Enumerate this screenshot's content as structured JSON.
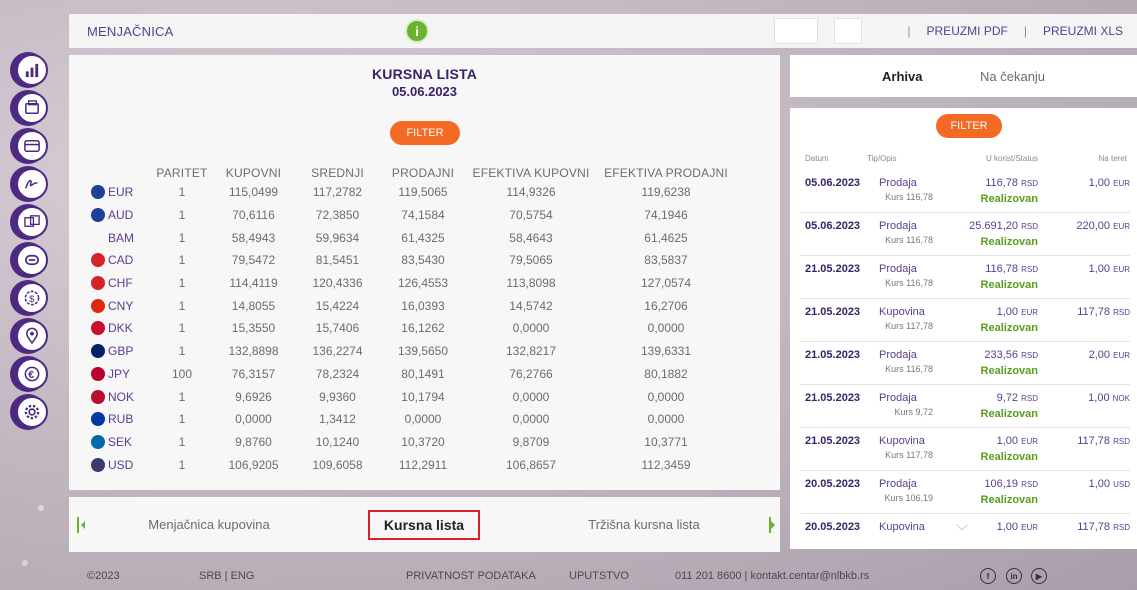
{
  "topbar": {
    "app_title": "MENJAČNICA",
    "info_icon": "info-icon",
    "separator": "|",
    "download_pdf": "PREUZMI PDF",
    "download_xls": "PREUZMI XLS"
  },
  "sidebar": {
    "items": [
      {
        "icon": "bar-chart-icon"
      },
      {
        "icon": "wallet-icon"
      },
      {
        "icon": "card-icon"
      },
      {
        "icon": "signature-icon"
      },
      {
        "icon": "money-transfer-icon"
      },
      {
        "icon": "loan-icon"
      },
      {
        "icon": "dollar-coin-icon"
      },
      {
        "icon": "location-pin-icon"
      },
      {
        "icon": "euro-exchange-icon"
      },
      {
        "icon": "gear-icon"
      }
    ],
    "accent": "#4c2a82"
  },
  "main": {
    "title": "KURSNA LISTA",
    "date": "05.06.2023",
    "filter_label": "FILTER",
    "columns": [
      "PARITET",
      "KUPOVNI",
      "SREDNJI",
      "PRODAJNI",
      "EFEKTIVA KUPOVNI",
      "EFEKTIVA PRODAJNI"
    ],
    "rows": [
      {
        "code": "EUR",
        "flag": "#1f3f9a",
        "paritet": "1",
        "kupovni": "115,0499",
        "srednji": "117,2782",
        "prodajni": "119,5065",
        "ef_kupovni": "114,9326",
        "ef_prodajni": "119,6238"
      },
      {
        "code": "AUD",
        "flag": "#1f3f9a",
        "paritet": "1",
        "kupovni": "70,6116",
        "srednji": "72,3850",
        "prodajni": "74,1584",
        "ef_kupovni": "70,5754",
        "ef_prodajni": "74,1946"
      },
      {
        "code": "BAM",
        "flag": "",
        "paritet": "1",
        "kupovni": "58,4943",
        "srednji": "59,9634",
        "prodajni": "61,4325",
        "ef_kupovni": "58,4643",
        "ef_prodajni": "61,4625"
      },
      {
        "code": "CAD",
        "flag": "#d7222a",
        "paritet": "1",
        "kupovni": "79,5472",
        "srednji": "81,5451",
        "prodajni": "83,5430",
        "ef_kupovni": "79,5065",
        "ef_prodajni": "83,5837"
      },
      {
        "code": "CHF",
        "flag": "#d7222a",
        "paritet": "1",
        "kupovni": "114,4119",
        "srednji": "120,4336",
        "prodajni": "126,4553",
        "ef_kupovni": "113,8098",
        "ef_prodajni": "127,0574"
      },
      {
        "code": "CNY",
        "flag": "#de2910",
        "paritet": "1",
        "kupovni": "14,8055",
        "srednji": "15,4224",
        "prodajni": "16,0393",
        "ef_kupovni": "14,5742",
        "ef_prodajni": "16,2706"
      },
      {
        "code": "DKK",
        "flag": "#c8102e",
        "paritet": "1",
        "kupovni": "15,3550",
        "srednji": "15,7406",
        "prodajni": "16,1262",
        "ef_kupovni": "0,0000",
        "ef_prodajni": "0,0000"
      },
      {
        "code": "GBP",
        "flag": "#012169",
        "paritet": "1",
        "kupovni": "132,8898",
        "srednji": "136,2274",
        "prodajni": "139,5650",
        "ef_kupovni": "132,8217",
        "ef_prodajni": "139,6331"
      },
      {
        "code": "JPY",
        "flag": "#bc002d",
        "paritet": "100",
        "kupovni": "76,3157",
        "srednji": "78,2324",
        "prodajni": "80,1491",
        "ef_kupovni": "76,2766",
        "ef_prodajni": "80,1882"
      },
      {
        "code": "NOK",
        "flag": "#ba0c2f",
        "paritet": "1",
        "kupovni": "9,6926",
        "srednji": "9,9360",
        "prodajni": "10,1794",
        "ef_kupovni": "0,0000",
        "ef_prodajni": "0,0000"
      },
      {
        "code": "RUB",
        "flag": "#0039a6",
        "paritet": "1",
        "kupovni": "0,0000",
        "srednji": "1,3412",
        "prodajni": "0,0000",
        "ef_kupovni": "0,0000",
        "ef_prodajni": "0,0000"
      },
      {
        "code": "SEK",
        "flag": "#006aa7",
        "paritet": "1",
        "kupovni": "9,8760",
        "srednji": "10,1240",
        "prodajni": "10,3720",
        "ef_kupovni": "9,8709",
        "ef_prodajni": "10,3771"
      },
      {
        "code": "USD",
        "flag": "#3c3b6e",
        "paritet": "1",
        "kupovni": "106,9205",
        "srednji": "109,6058",
        "prodajni": "112,2911",
        "ef_kupovni": "106,8657",
        "ef_prodajni": "112,3459"
      }
    ]
  },
  "tabs": [
    {
      "label": "Menjačnica kupovina"
    },
    {
      "label": "Kursna lista"
    },
    {
      "label": "Tržišna kursna lista"
    }
  ],
  "right": {
    "tab_archive": "Arhiva",
    "tab_pending": "Na čekanju",
    "filter_label": "FILTER",
    "headers": {
      "datum": "Datum",
      "tip": "Tip/Opis",
      "korist": "U korist/Status",
      "teret": "Na teret"
    },
    "transactions": [
      {
        "date": "05.06.2023",
        "type": "Prodaja",
        "kurs": "Kurs 116,78",
        "amount": "116,78",
        "amount_cur": "RSD",
        "status": "Realizovan",
        "debit": "1,00",
        "debit_cur": "EUR"
      },
      {
        "date": "05.06.2023",
        "type": "Prodaja",
        "kurs": "Kurs 116,78",
        "amount": "25.691,20",
        "amount_cur": "RSD",
        "status": "Realizovan",
        "debit": "220,00",
        "debit_cur": "EUR"
      },
      {
        "date": "21.05.2023",
        "type": "Prodaja",
        "kurs": "Kurs 116,78",
        "amount": "116,78",
        "amount_cur": "RSD",
        "status": "Realizovan",
        "debit": "1,00",
        "debit_cur": "EUR"
      },
      {
        "date": "21.05.2023",
        "type": "Kupovina",
        "kurs": "Kurs 117,78",
        "amount": "1,00",
        "amount_cur": "EUR",
        "status": "Realizovan",
        "debit": "117,78",
        "debit_cur": "RSD"
      },
      {
        "date": "21.05.2023",
        "type": "Prodaja",
        "kurs": "Kurs 116,78",
        "amount": "233,56",
        "amount_cur": "RSD",
        "status": "Realizovan",
        "debit": "2,00",
        "debit_cur": "EUR"
      },
      {
        "date": "21.05.2023",
        "type": "Prodaja",
        "kurs": "Kurs 9,72",
        "amount": "9,72",
        "amount_cur": "RSD",
        "status": "Realizovan",
        "debit": "1,00",
        "debit_cur": "NOK"
      },
      {
        "date": "21.05.2023",
        "type": "Kupovina",
        "kurs": "Kurs 117,78",
        "amount": "1,00",
        "amount_cur": "EUR",
        "status": "Realizovan",
        "debit": "117,78",
        "debit_cur": "RSD"
      },
      {
        "date": "20.05.2023",
        "type": "Prodaja",
        "kurs": "Kurs 106,19",
        "amount": "106,19",
        "amount_cur": "RSD",
        "status": "Realizovan",
        "debit": "1,00",
        "debit_cur": "USD"
      },
      {
        "date": "20.05.2023",
        "type": "Kupovina",
        "kurs": "",
        "amount": "1,00",
        "amount_cur": "EUR",
        "status": "",
        "debit": "117,78",
        "debit_cur": "RSD"
      }
    ]
  },
  "footer": {
    "copyright": "©2023",
    "lang": "SRB | ENG",
    "privacy": "PRIVATNOST PODATAKA",
    "guide": "UPUTSTVO",
    "contact": "011 201 8600 | kontakt.centar@nlbkb.rs",
    "social": [
      "facebook-icon",
      "linkedin-icon",
      "youtube-icon"
    ]
  },
  "colors": {
    "accent_orange": "#f26a24",
    "purple": "#4c2a82",
    "green": "#6ab42d",
    "highlight": "#d7222a"
  }
}
